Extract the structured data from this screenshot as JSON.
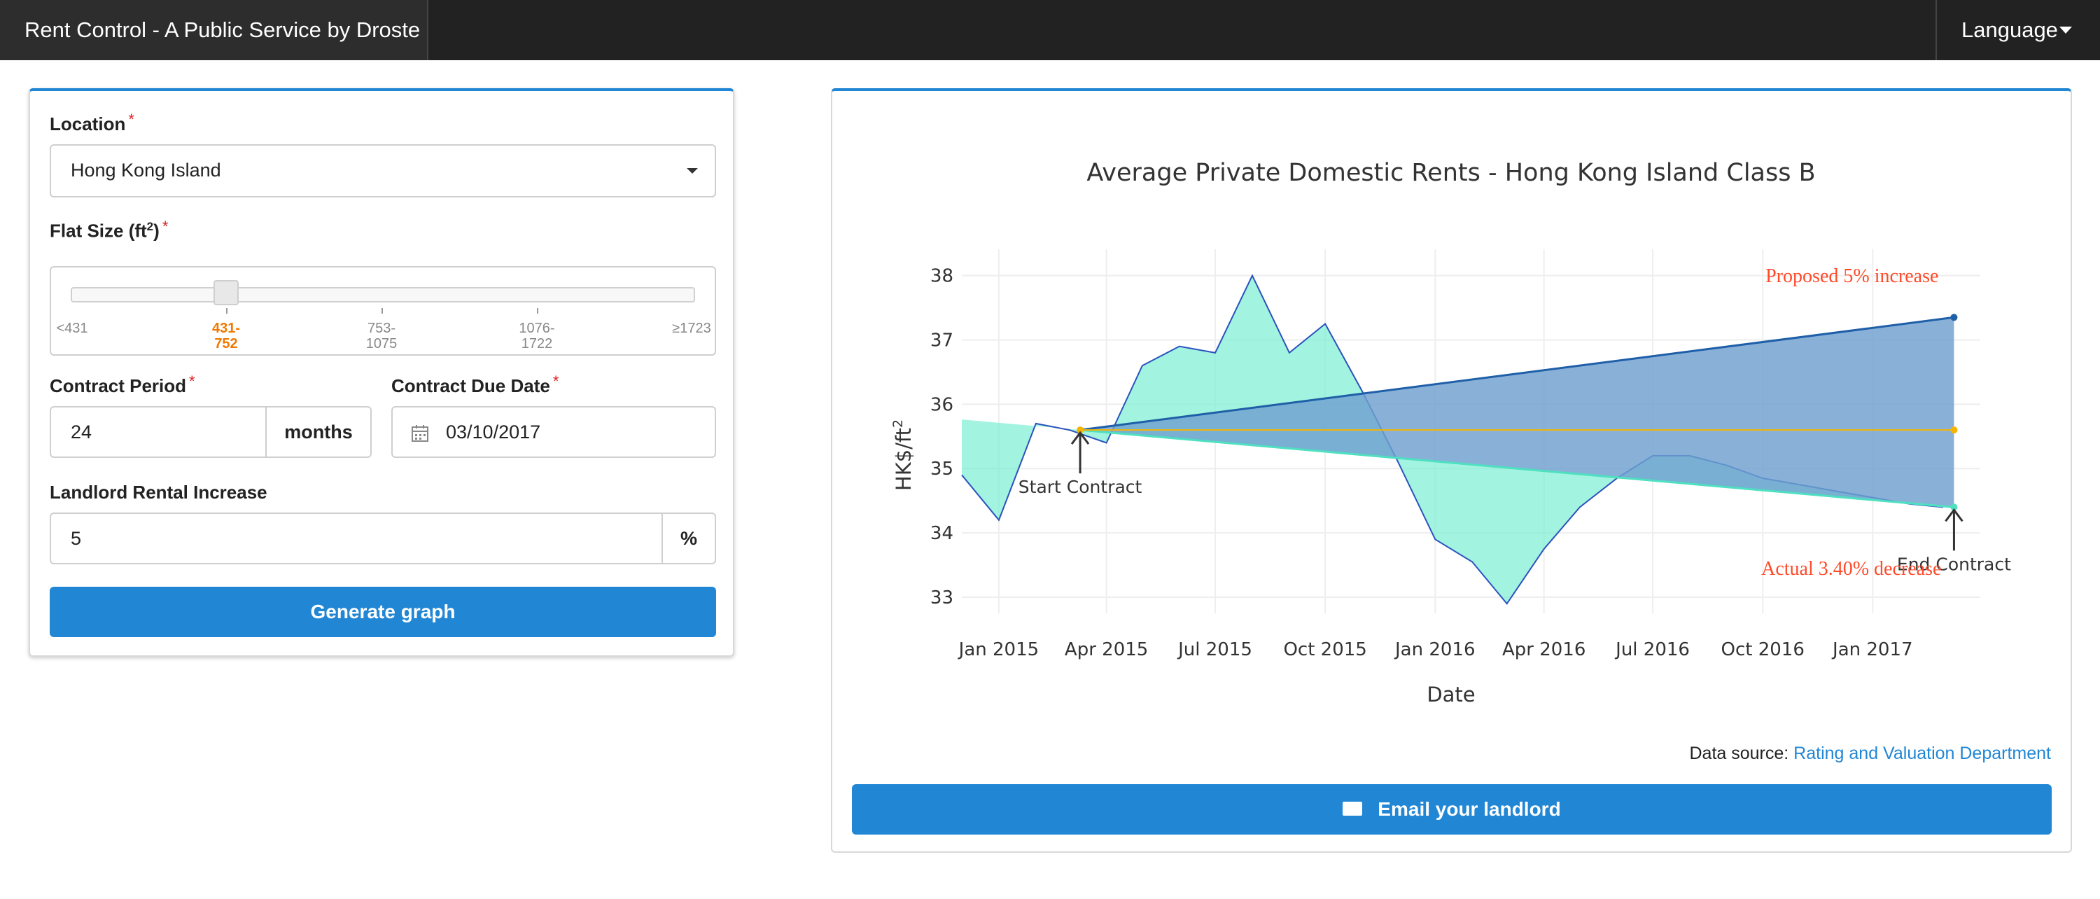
{
  "navbar": {
    "brand": "Rent Control - A Public Service by Droste",
    "language": "Language"
  },
  "form": {
    "location_label": "Location",
    "location_value": "Hong Kong Island",
    "flat_size_label": "Flat Size (ft",
    "flat_size_sup": "2",
    "flat_size_close": ")",
    "flat_size_ticks": [
      "<431",
      "431-\n752",
      "753-\n1075",
      "1076-\n1722",
      "≥1723"
    ],
    "flat_size_selected_index": 1,
    "contract_period_label": "Contract Period",
    "contract_period_value": "24",
    "contract_period_unit": "months",
    "due_date_label": "Contract Due Date",
    "due_date_value": "03/10/2017",
    "increase_label": "Landlord Rental Increase",
    "increase_value": "5",
    "increase_unit": "%",
    "required_mark": "*",
    "generate_label": "Generate graph"
  },
  "footer": {
    "source_prefix": "Data source: ",
    "source_link": "Rating and Valuation Department",
    "email_label": "Email your landlord"
  },
  "chart_data": {
    "type": "area",
    "title": "Average Private Domestic Rents - Hong Kong Island Class B",
    "xlabel": "Date",
    "ylabel": "HK$/ft",
    "ylabel_sup": "2",
    "x_ticks": [
      "Jan 2015",
      "Apr 2015",
      "Jul 2015",
      "Oct 2015",
      "Jan 2016",
      "Apr 2016",
      "Jul 2016",
      "Oct 2016",
      "Jan 2017"
    ],
    "y_ticks": [
      33,
      34,
      35,
      36,
      37,
      38
    ],
    "ylim": [
      32.75,
      38.3
    ],
    "xlim": [
      "2014-12-01",
      "2017-04-01"
    ],
    "grid": true,
    "series": [
      {
        "x": [
          "2014-12-01",
          "2015-01-01",
          "2015-02-01",
          "2015-03-01",
          "2015-04-01",
          "2015-05-01",
          "2015-06-01",
          "2015-07-01",
          "2015-08-01",
          "2015-09-01",
          "2015-10-01",
          "2015-11-01",
          "2015-12-01",
          "2016-01-01",
          "2016-02-01",
          "2016-03-01",
          "2016-04-01",
          "2016-05-01",
          "2016-06-01",
          "2016-07-01",
          "2016-08-01",
          "2016-09-01",
          "2016-10-01",
          "2016-11-01",
          "2016-12-01",
          "2017-01-01",
          "2017-02-01",
          "2017-03-01"
        ],
        "y": [
          34.9,
          34.2,
          35.7,
          35.6,
          35.4,
          36.6,
          36.9,
          36.8,
          38.0,
          36.8,
          37.25,
          36.2,
          35.1,
          33.9,
          33.55,
          32.9,
          33.75,
          34.4,
          34.85,
          35.2,
          35.2,
          35.05,
          34.85,
          34.75,
          34.65,
          34.55,
          34.45,
          34.4
        ]
      }
    ],
    "contract": {
      "start": "2015-03-10",
      "end": "2017-03-10",
      "start_rent": 35.6,
      "proposed_end": 37.35,
      "actual_end": 34.4
    },
    "annotations": {
      "start": "Start Contract",
      "end": "End Contract",
      "proposed": "Proposed 5% increase",
      "actual": "Actual 3.40% decrease"
    },
    "colors": {
      "area": "#7aeed2",
      "line": "#2a52be",
      "proposed": "#1f5fa8",
      "baseline": "#f5b400",
      "annotation": "#ff4a2a",
      "actual": "#4ee0c0"
    }
  }
}
